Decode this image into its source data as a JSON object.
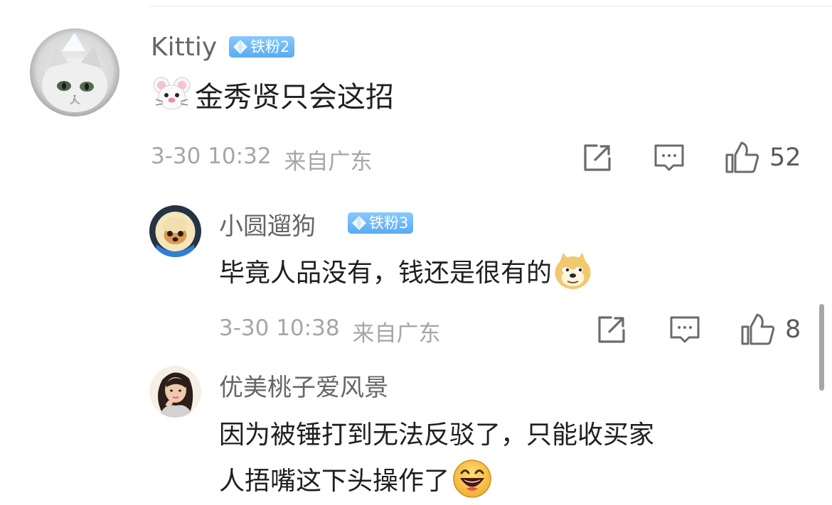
{
  "comments": [
    {
      "username": "Kittiy",
      "badge": "铁粉2",
      "text": "金秀贤只会这招",
      "leading_emoji": "mouse-face-icon",
      "time": "3-30 10:32",
      "location": "来自广东",
      "likes": "52"
    },
    {
      "username": "小圆遛狗",
      "badge": "铁粉3",
      "text": "毕竟人品没有，钱还是很有的",
      "trailing_emoji": "doge-face-icon",
      "time": "3-30 10:38",
      "location": "来自广东",
      "likes": "8"
    },
    {
      "username": "优美桃子爱风景",
      "text_line_1": "因为被锤打到无法反驳了，只能收买家",
      "text_line_2": "人捂嘴这下头操作了",
      "trailing_emoji": "laughing-face-icon"
    }
  ],
  "icons": {
    "share": "share-icon",
    "comment": "comment-icon",
    "like": "like-icon"
  },
  "colors": {
    "badge": "#59abf1",
    "meta_text": "#a6a6a6",
    "username_text": "#666666",
    "body_text": "#1f1f1f"
  }
}
